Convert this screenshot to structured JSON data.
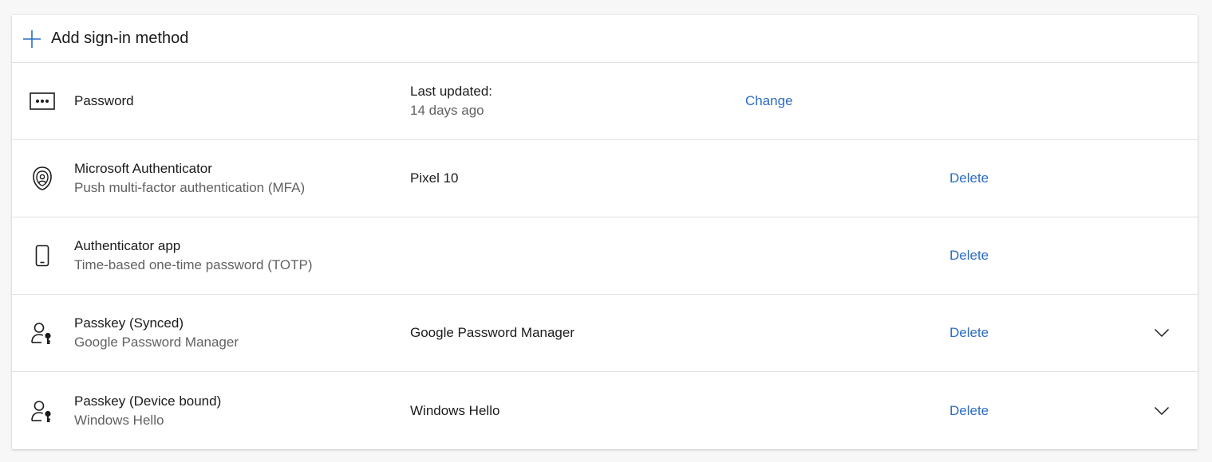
{
  "add_method": {
    "label": "Add sign-in method",
    "icon": "plus-icon"
  },
  "methods": [
    {
      "icon": "password-icon",
      "title": "Password",
      "subtitle": "",
      "detail_label": "Last updated:",
      "detail_value": "14 days ago",
      "action": "Change",
      "expandable": false
    },
    {
      "icon": "microsoft-authenticator-icon",
      "title": "Microsoft Authenticator",
      "subtitle": "Push multi-factor authentication (MFA)",
      "detail_label": "Pixel 10",
      "detail_value": "",
      "action": "Delete",
      "expandable": false
    },
    {
      "icon": "phone-icon",
      "title": "Authenticator app",
      "subtitle": "Time-based one-time password (TOTP)",
      "detail_label": "",
      "detail_value": "",
      "action": "Delete",
      "expandable": false
    },
    {
      "icon": "passkey-icon",
      "title": "Passkey (Synced)",
      "subtitle": "Google Password Manager",
      "detail_label": "Google Password Manager",
      "detail_value": "",
      "action": "Delete",
      "expandable": true
    },
    {
      "icon": "passkey-icon",
      "title": "Passkey (Device bound)",
      "subtitle": "Windows Hello",
      "detail_label": "Windows Hello",
      "detail_value": "",
      "action": "Delete",
      "expandable": true
    }
  ],
  "colors": {
    "link": "#2b6cc4",
    "text": "#1b1b1b",
    "muted": "#616161",
    "divider": "#e1e1e1"
  }
}
